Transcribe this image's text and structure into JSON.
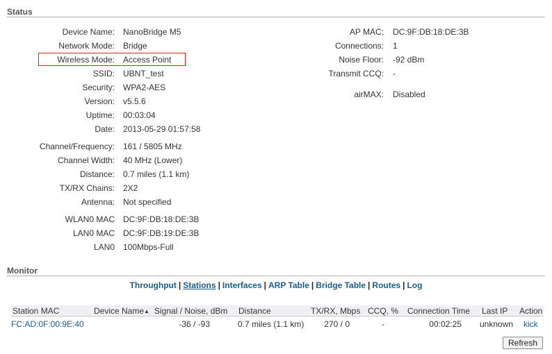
{
  "status": {
    "title": "Status",
    "left": [
      {
        "label": "Device Name:",
        "value": "NanoBridge M5"
      },
      {
        "label": "Network Mode:",
        "value": "Bridge"
      },
      {
        "label": "Wireless Mode:",
        "value": "Access Point"
      },
      {
        "label": "SSID:",
        "value": "UBNT_test"
      },
      {
        "label": "Security:",
        "value": "WPA2-AES"
      },
      {
        "label": "Version:",
        "value": "v5.5.6"
      },
      {
        "label": "Uptime:",
        "value": "00:03:04"
      },
      {
        "label": "Date:",
        "value": "2013-05-29 01:57:58"
      },
      {
        "label": "Channel/Frequency:",
        "value": "161 / 5805 MHz"
      },
      {
        "label": "Channel Width:",
        "value": "40 MHz (Lower)"
      },
      {
        "label": "Distance:",
        "value": "0.7 miles (1.1 km)"
      },
      {
        "label": "TX/RX Chains:",
        "value": "2X2"
      },
      {
        "label": "Antenna:",
        "value": "Not specified"
      },
      {
        "label": "WLAN0 MAC",
        "value": "DC:9F:DB:18:DE:3B"
      },
      {
        "label": "LAN0 MAC",
        "value": "DC:9F:DB:19:DE:3B"
      },
      {
        "label": "LAN0",
        "value": "100Mbps-Full"
      }
    ],
    "right": [
      {
        "label": "AP MAC:",
        "value": "DC:9F:DB:18:DE:3B"
      },
      {
        "label": "Connections:",
        "value": "1"
      },
      {
        "label": "Noise Floor:",
        "value": "-92 dBm"
      },
      {
        "label": "Transmit CCQ:",
        "value": "-"
      },
      {
        "label": "airMAX:",
        "value": "Disabled"
      }
    ]
  },
  "monitor": {
    "title": "Monitor",
    "tabs": [
      "Throughput",
      "Stations",
      "Interfaces",
      "ARP Table",
      "Bridge Table",
      "Routes",
      "Log"
    ],
    "separator": "|",
    "active_tab": "Stations"
  },
  "stations": {
    "headers": [
      "Station MAC",
      "Device Name",
      "Signal / Noise, dBm",
      "Distance",
      "TX/RX, Mbps",
      "CCQ, %",
      "Connection Time",
      "Last IP",
      "Action"
    ],
    "sort_arrow": "▲",
    "rows": [
      [
        "FC:AD:0F:00:9E:40",
        "",
        "-36 / -93",
        "0.7 miles (1.1 km)",
        "270 / 0",
        "-",
        "00:02:25",
        "unknown",
        "kick"
      ]
    ]
  },
  "refresh_label": "Refresh",
  "colors": {
    "link": "#1a5f8e",
    "highlight_box": "#dd2222",
    "header_bg": "#eef0f3"
  }
}
